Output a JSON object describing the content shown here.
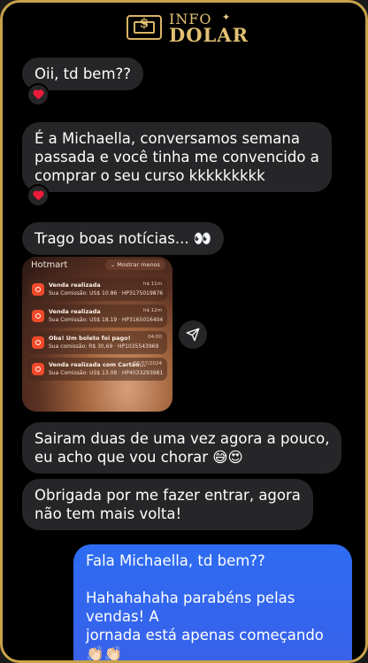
{
  "brand": {
    "top": "INFO",
    "bottom": "DOLAR",
    "currency_symbol": "$",
    "gold": "#c9a24a"
  },
  "messages": {
    "m1": "Oii, td bem??",
    "m2": "É a Michaella, conversamos semana\npassada e você tinha me convencido a\ncomprar o seu curso kkkkkkkkk",
    "m3": "Trago boas notícias... 👀",
    "m4": "Sairam duas de uma vez agora a pouco,\neu acho que vou chorar 😅😍",
    "m5": "Obrigada por me fazer entrar, agora\nnão tem mais volta!",
    "m6": "Fala Michaella, td bem??\n\nHahahahaha parabéns pelas vendas! A\njornada está apenas começando 👏🏻👏🏻\n🙌🏻"
  },
  "reaction_icon": "heart-icon",
  "screenshot": {
    "app": "Hotmart",
    "hide_label": "⌄ Mostrar menos",
    "notifications": [
      {
        "title": "Venda realizada",
        "subtitle": "Sua Comissão: US$ 10.86 · HP3175019876",
        "time": "há 11m"
      },
      {
        "title": "Venda realizada",
        "subtitle": "Sua Comissão: US$ 18.19 · HP3165016404",
        "time": "há 12m"
      },
      {
        "title": "Oba! Um boleto foi pago!",
        "subtitle": "Sua comissão: R$ 30,69 · HP1035543969",
        "time": "04:00"
      },
      {
        "title": "Venda realizada com Cartão...",
        "subtitle": "Sua Comissão: US$ 13.08 · HP4033293981",
        "time": "05/07/2024"
      }
    ]
  },
  "colors": {
    "incoming": "#262628",
    "outgoing": "#3b63ee",
    "background": "#000000"
  }
}
